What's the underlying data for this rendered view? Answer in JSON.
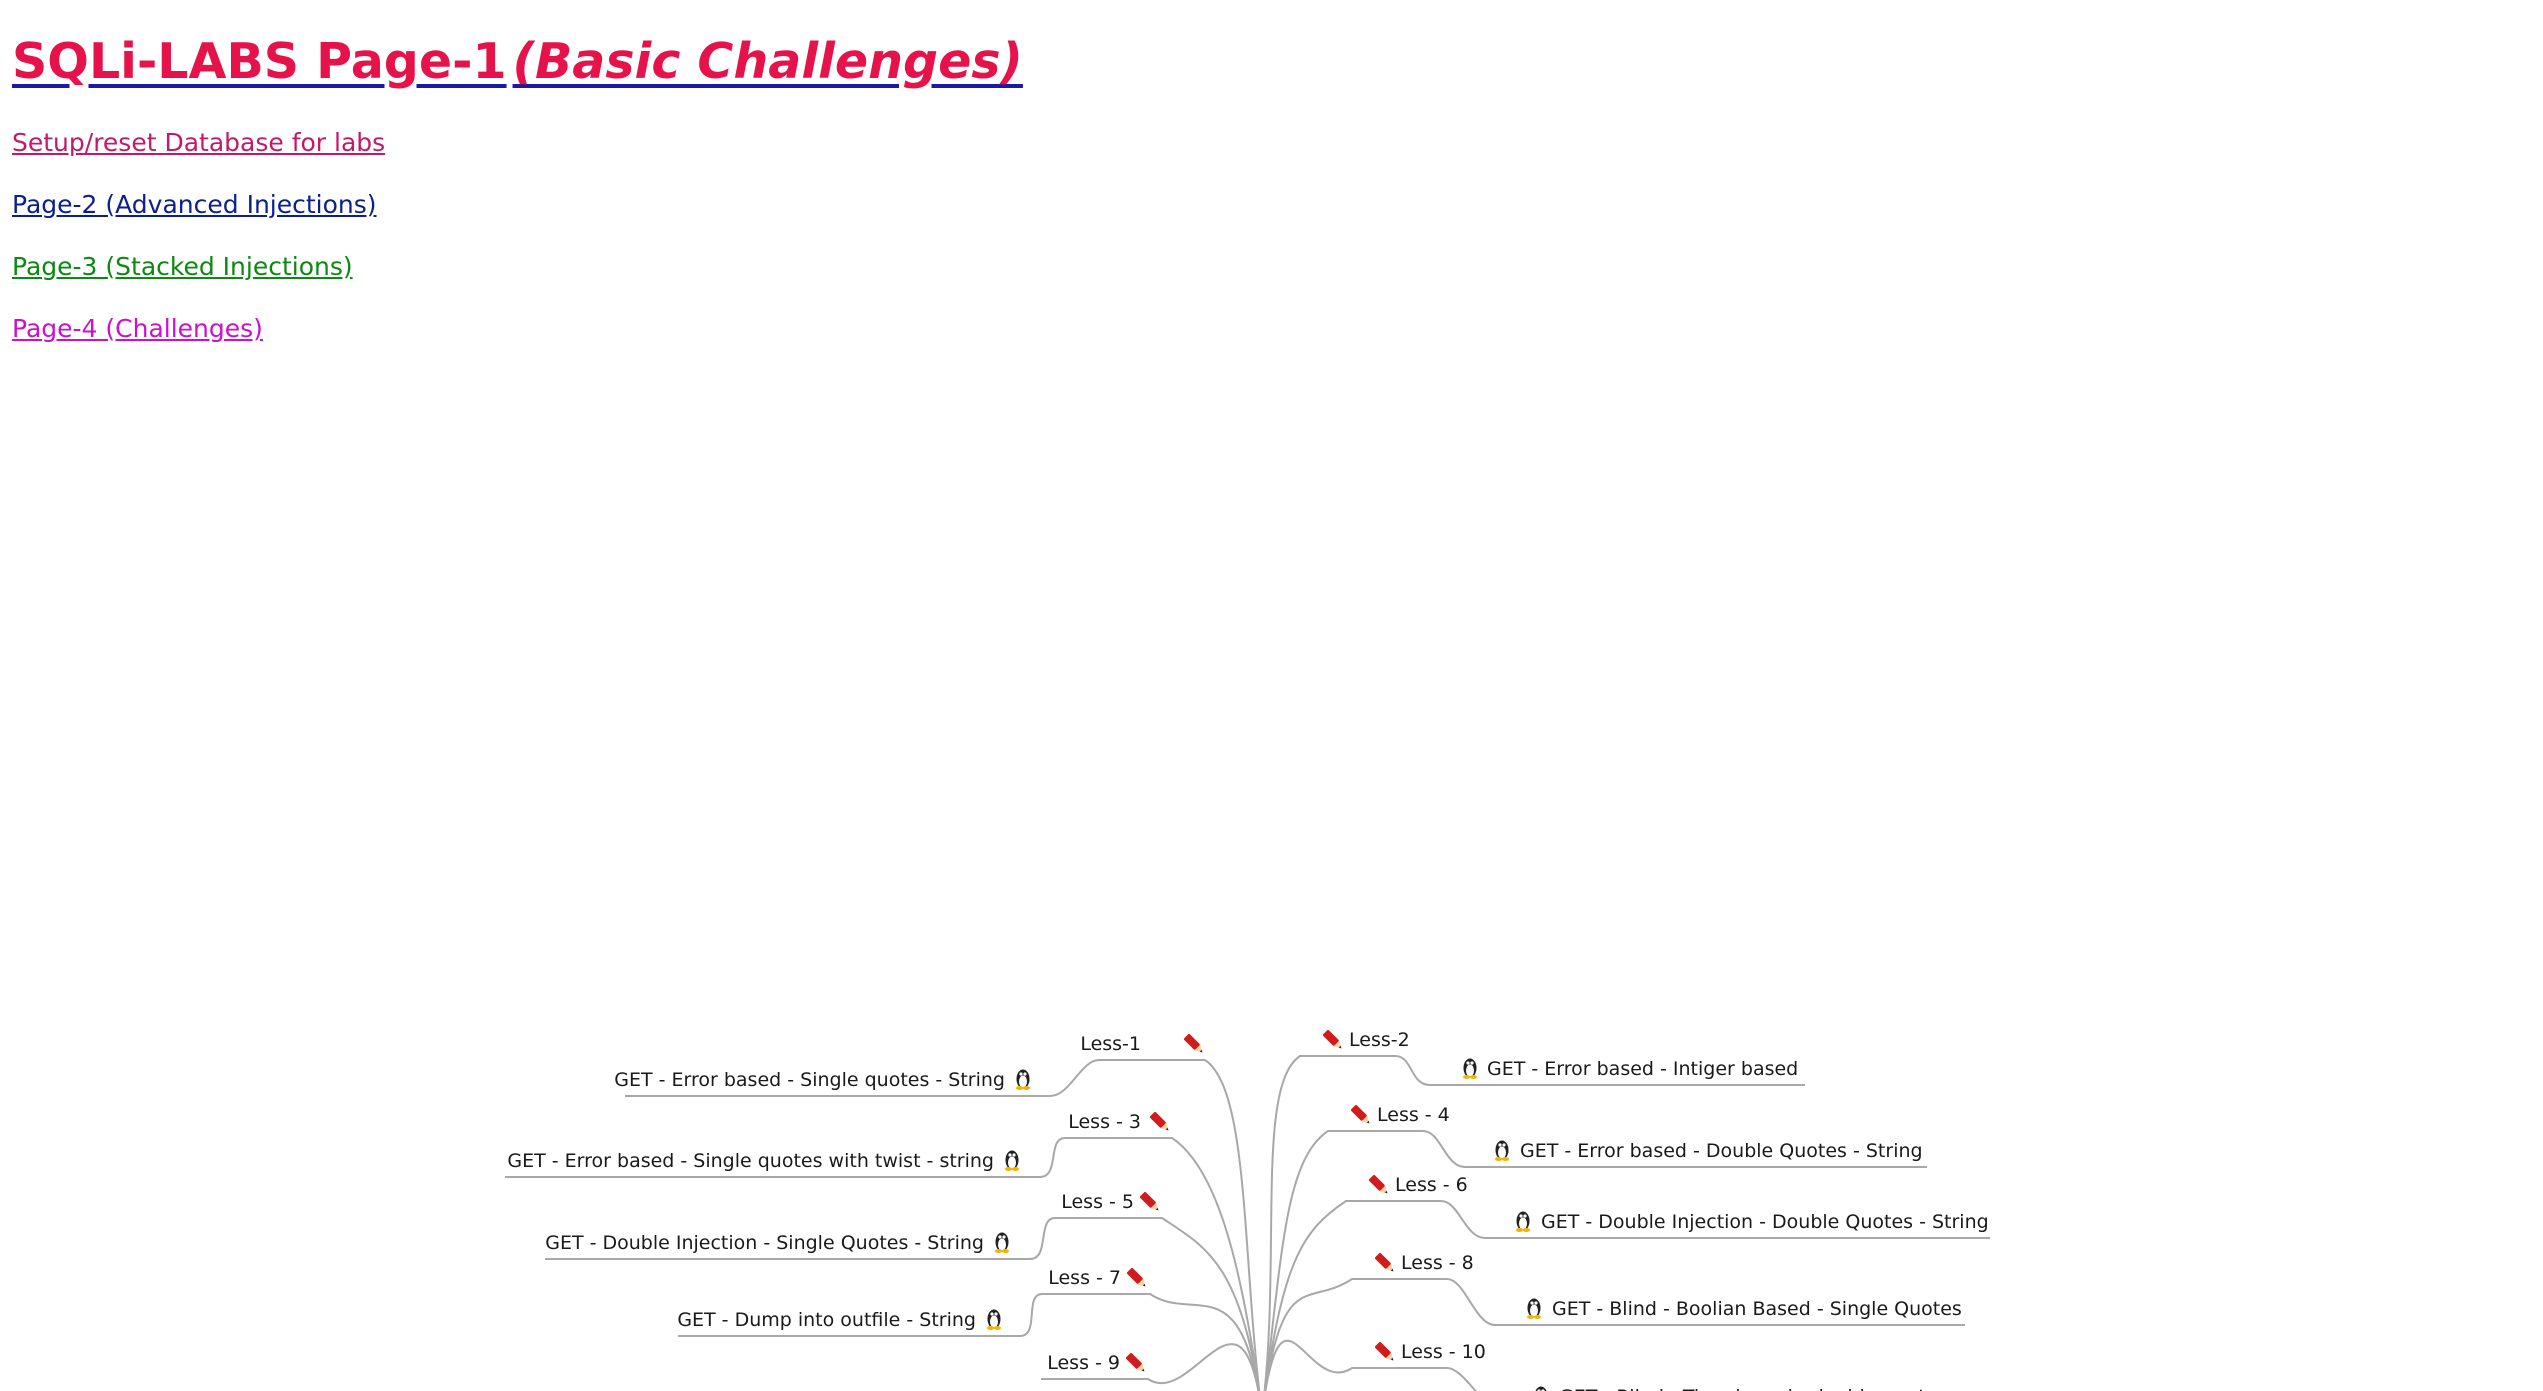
{
  "header": {
    "title": "SQLi-LABS Page-1",
    "subtitle": "(Basic Challenges)"
  },
  "links": [
    {
      "label": "Setup/reset Database for labs",
      "color": "#c4196b"
    },
    {
      "label": "Page-2 (Advanced Injections)",
      "color": "#0b1f8e"
    },
    {
      "label": "Page-3 (Stacked Injections)",
      "color": "#0b8a10"
    },
    {
      "label": "Page-4 (Challenges)",
      "color": "#cc10cc"
    }
  ],
  "mindmap": {
    "icons": {
      "lesson": "pencil-icon",
      "topic": "linux-penguin-icon"
    },
    "colors": {
      "connector": "#a8a8a8",
      "pencil": "#d01c1c"
    },
    "left": [
      {
        "lesson": "Less-1",
        "topic": "GET - Error based - Single quotes - String"
      },
      {
        "lesson": "Less - 3",
        "topic": "GET - Error based - Single quotes with twist - string"
      },
      {
        "lesson": "Less - 5",
        "topic": "GET - Double Injection - Single Quotes - String"
      },
      {
        "lesson": "Less - 7",
        "topic": "GET - Dump into outfile - String"
      },
      {
        "lesson": "Less - 9",
        "topic": ""
      }
    ],
    "right": [
      {
        "lesson": "Less-2",
        "topic": "GET - Error based - Intiger based"
      },
      {
        "lesson": "Less - 4",
        "topic": "GET - Error based - Double Quotes - String"
      },
      {
        "lesson": "Less - 6",
        "topic": "GET - Double Injection - Double Quotes - String"
      },
      {
        "lesson": "Less - 8",
        "topic": "GET - Blind - Boolian Based - Single Quotes"
      },
      {
        "lesson": "Less - 10",
        "topic": "GET - Blind - Time based - double quotes"
      }
    ]
  }
}
